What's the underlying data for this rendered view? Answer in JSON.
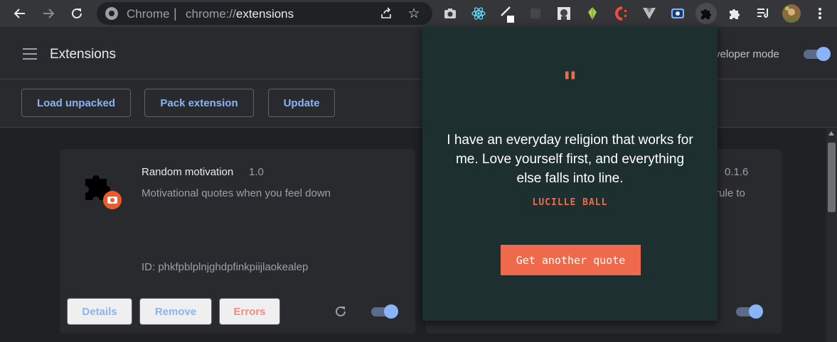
{
  "browser": {
    "site_label": "Chrome",
    "separator": "|",
    "url_scheme": "chrome://",
    "url_path": "extensions"
  },
  "header": {
    "title": "Extensions",
    "developer_mode_label": "veloper mode"
  },
  "actions": {
    "load_unpacked": "Load unpacked",
    "pack_extension": "Pack extension",
    "update": "Update"
  },
  "card_left": {
    "name": "Random motivation",
    "version": "1.0",
    "description": "Motivational quotes when you feel down",
    "id": "ID: phkfpblplnjghdpfinkpiijlaokealep",
    "details_label": "Details",
    "remove_label": "Remove",
    "errors_label": "Errors"
  },
  "card_right": {
    "version": "0.1.6",
    "description_fragment": ") rule to"
  },
  "popup": {
    "quote_mark": "\"",
    "quote": "I have an everyday religion that works for me. Love yourself first, and everything else falls into line.",
    "author": "LUCILLE BALL",
    "button_label": "Get another quote"
  },
  "colors": {
    "accent": "#ef6a4c",
    "popup_bg": "#1d2f2e",
    "link_blue": "#8ab4f8",
    "error_red": "#f28b82"
  }
}
